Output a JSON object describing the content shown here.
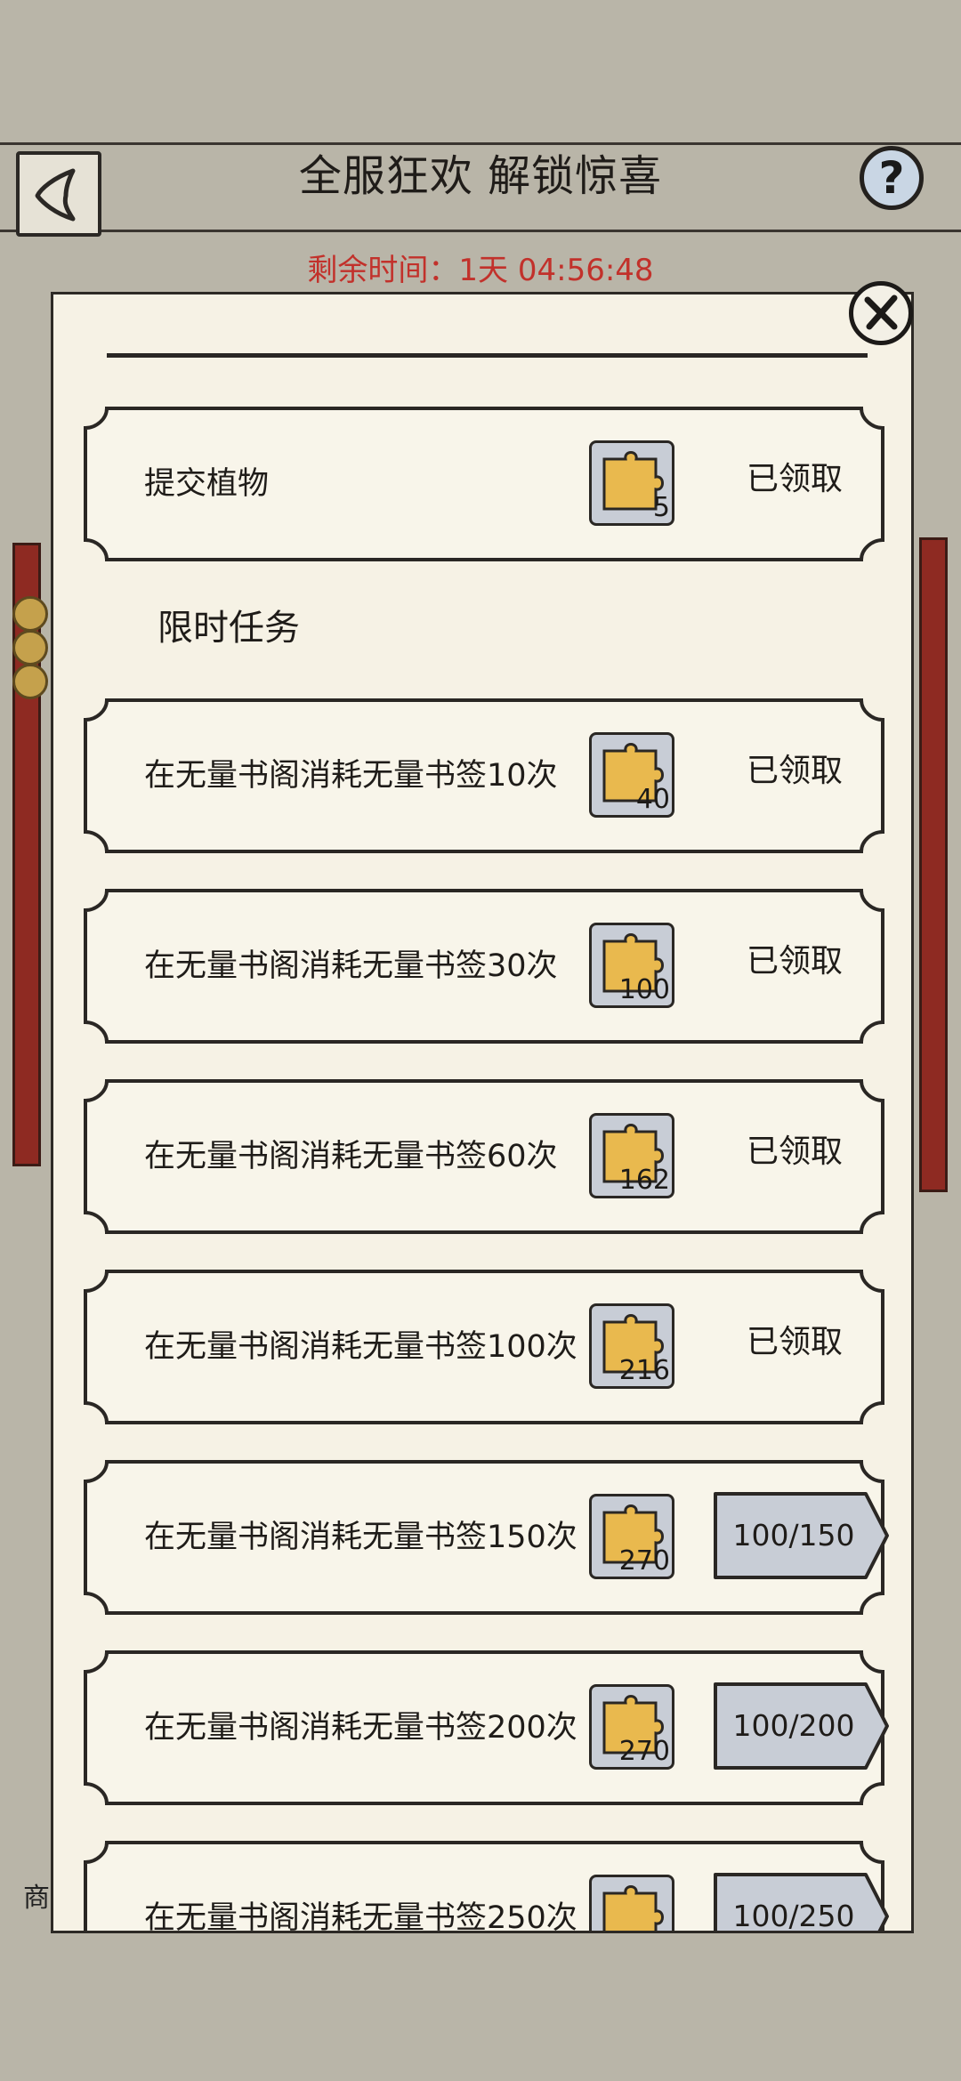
{
  "header": {
    "title": "全服狂欢 解锁惊喜",
    "help_label": "?",
    "timer_label": "剩余时间：",
    "timer_value": "1天 04:56:48"
  },
  "background": {
    "shop_label": "商"
  },
  "panel": {
    "section_limited": "限时任务",
    "tasks": [
      {
        "name": "提交植物",
        "reward": "5",
        "status": "已领取"
      },
      {
        "name": "在无量书阁消耗无量书签10次",
        "reward": "40",
        "status": "已领取"
      },
      {
        "name": "在无量书阁消耗无量书签30次",
        "reward": "100",
        "status": "已领取"
      },
      {
        "name": "在无量书阁消耗无量书签60次",
        "reward": "162",
        "status": "已领取"
      },
      {
        "name": "在无量书阁消耗无量书签100次",
        "reward": "216",
        "status": "已领取"
      },
      {
        "name": "在无量书阁消耗无量书签150次",
        "reward": "270",
        "progress": "100/150"
      },
      {
        "name": "在无量书阁消耗无量书签200次",
        "reward": "270",
        "progress": "100/200"
      },
      {
        "name": "在无量书阁消耗无量书签250次",
        "reward": "",
        "progress": "100/250"
      }
    ]
  },
  "colors": {
    "background": "#b9b5a8",
    "panel": "#f6f2e5",
    "timer_red": "#c2312b",
    "reward_gold": "#e9b94e",
    "reward_tile": "#c8cdd6",
    "progress_tag": "#c8cdd6",
    "rail_red": "#8e2a22"
  },
  "icons": {
    "back": "back-arrow-icon",
    "help": "question-icon",
    "close": "close-x-icon",
    "reward": "puzzle-piece-icon"
  }
}
